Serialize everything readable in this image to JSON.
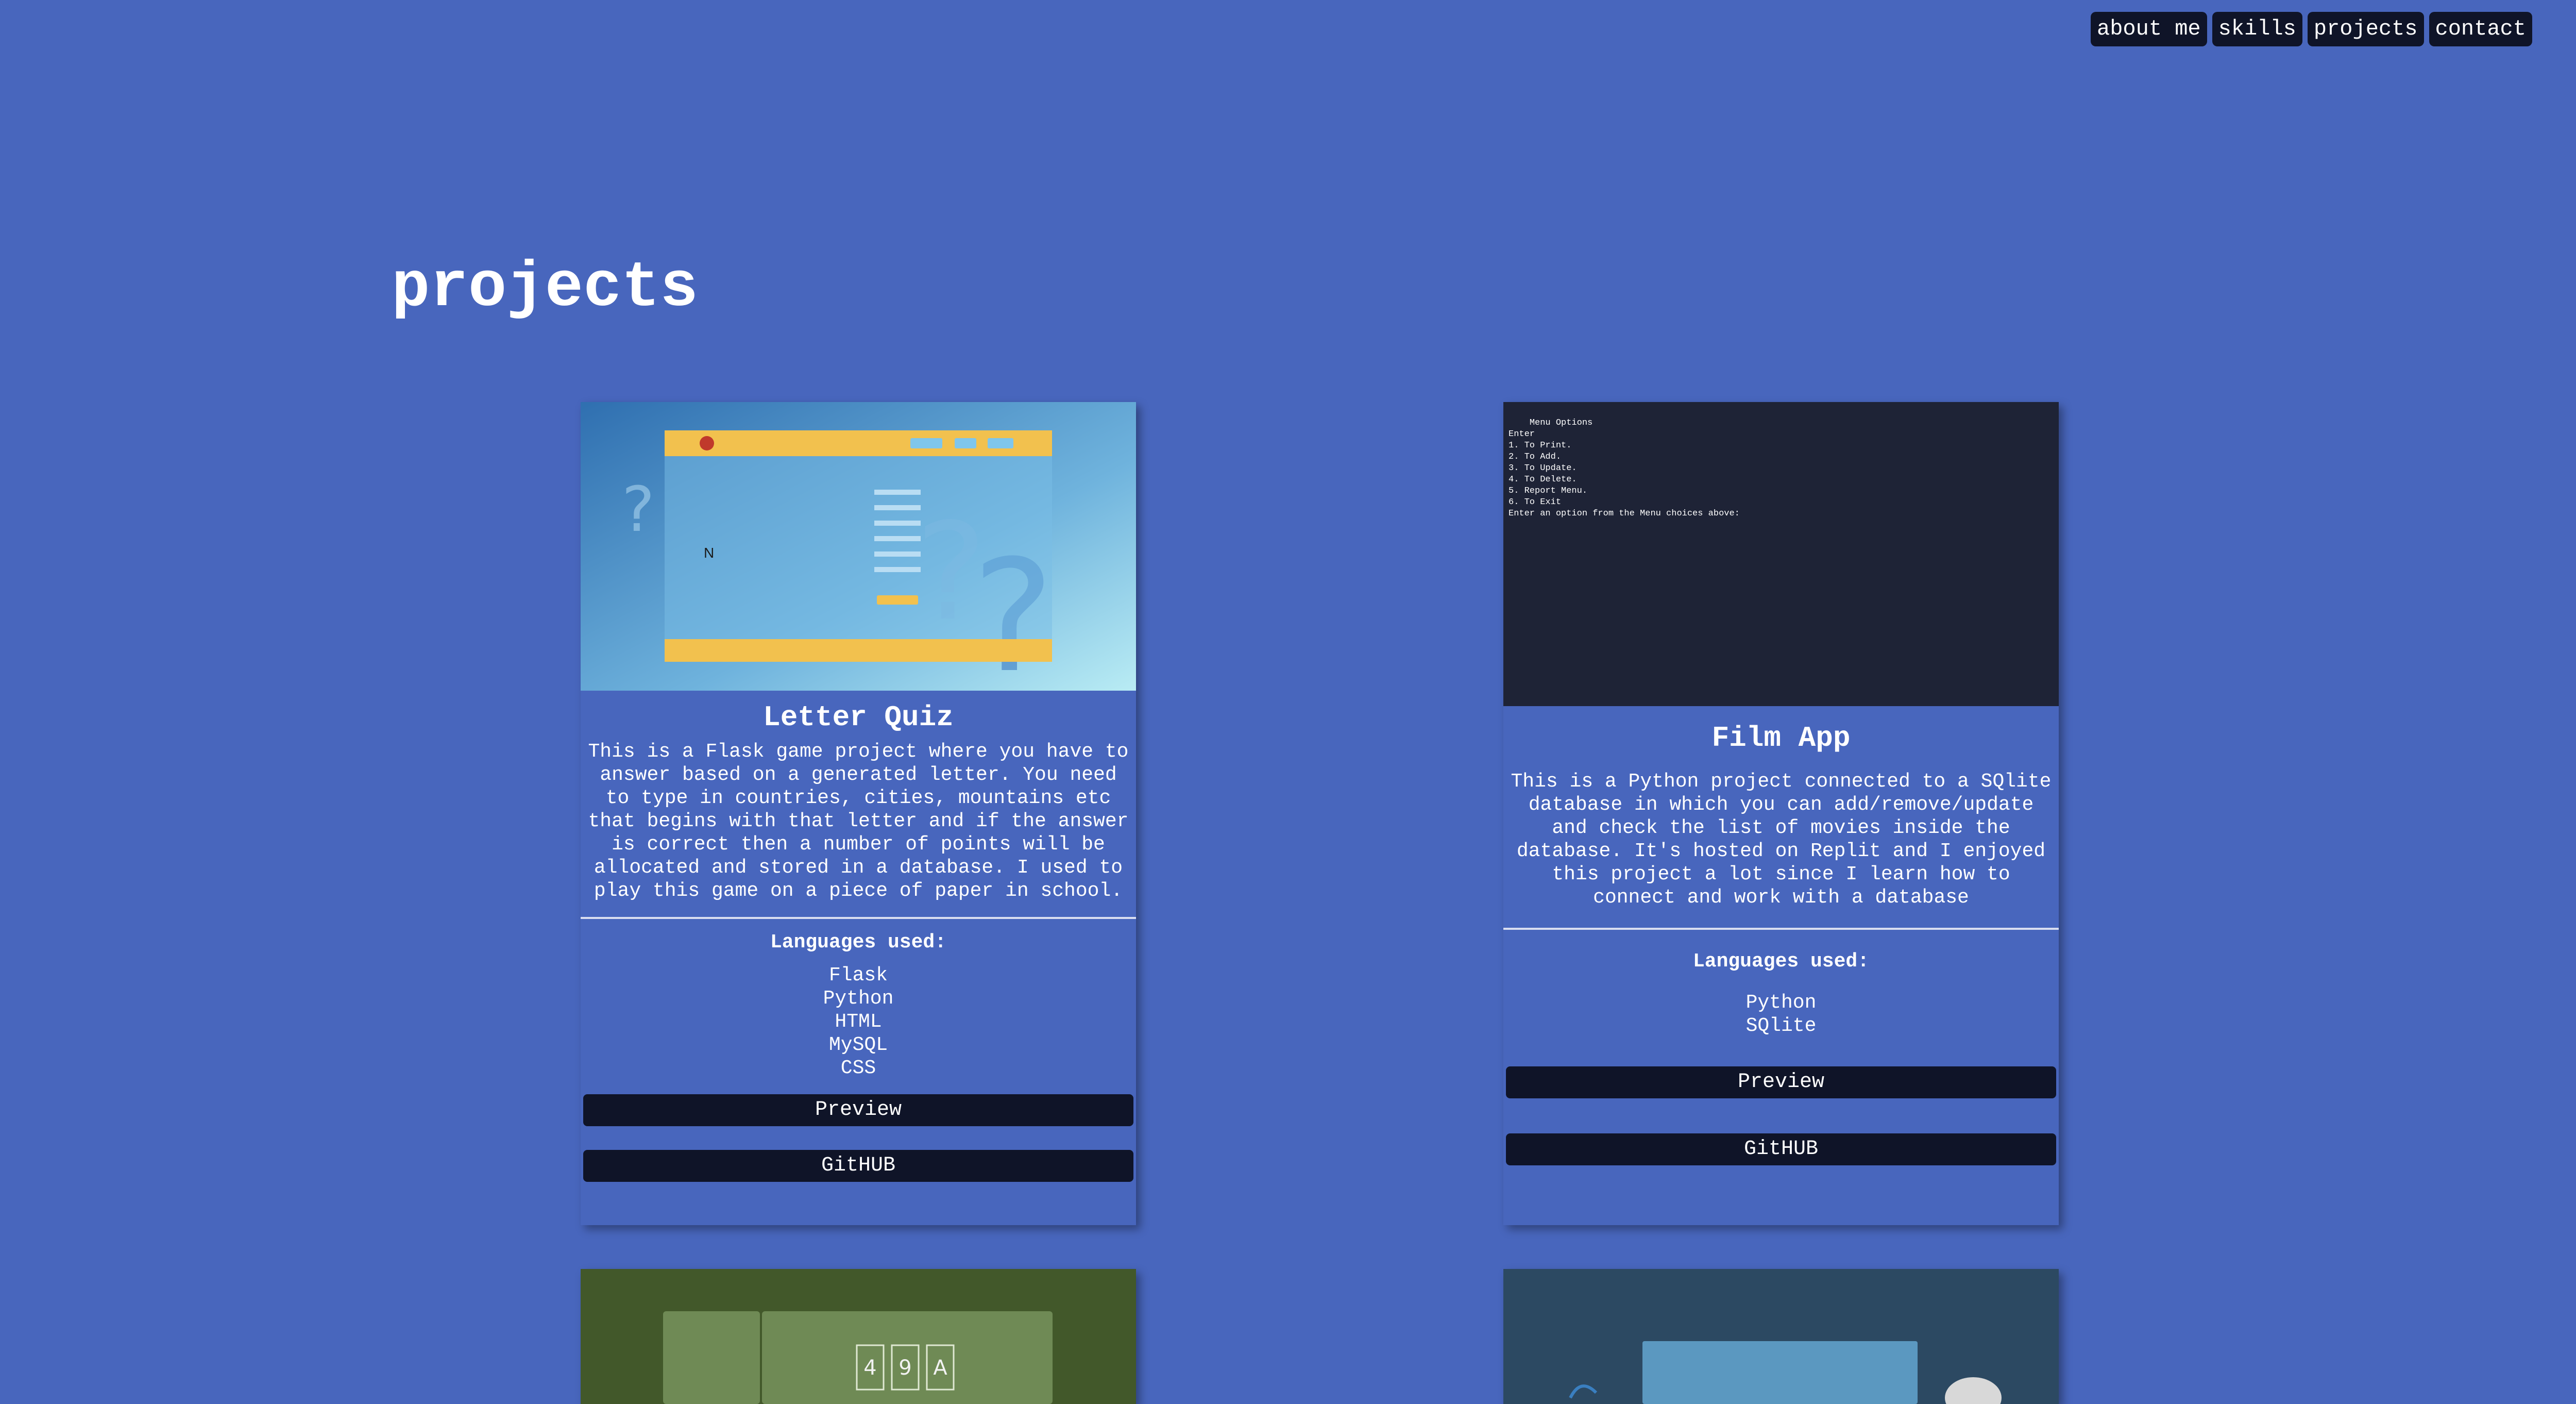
{
  "nav": {
    "about": "about me",
    "skills": "skills",
    "projects": "projects",
    "contact": "contact"
  },
  "page_title": "projects",
  "projects": [
    {
      "title": "Letter Quiz",
      "description": "This is a Flask game project where you have to answer based on a generated letter. You need to type in countries, cities, mountains etc that begins with that letter and if the answer is correct then a number of points will be allocated and stored in a database. I used to play this game on a piece of paper in school.",
      "languages_label": "Languages used:",
      "languages": [
        "Flask",
        "Python",
        "HTML",
        "MySQL",
        "CSS"
      ],
      "preview_label": "Preview",
      "github_label": "GitHUB",
      "screenshot": {
        "letter": "N"
      }
    },
    {
      "title": "Film App",
      "description": "This is a Python project connected to a SQlite database in which you can add/remove/update and check the list of movies inside the database. It's hosted on Replit and I enjoyed this project a lot since I learn how to connect and work with a database",
      "languages_label": "Languages used:",
      "languages": [
        "Python",
        "SQlite"
      ],
      "preview_label": "Preview",
      "github_label": "GitHUB",
      "screenshot": {
        "terminal": "Menu Options\nEnter\n1. To Print.\n2. To Add.\n3. To Update.\n4. To Delete.\n5. Report Menu.\n6. To Exit\nEnter an option from the Menu choices above:"
      }
    },
    {
      "screenshot": {
        "tiles": [
          "4",
          "9",
          "A"
        ]
      }
    },
    {
      "screenshot": {}
    }
  ],
  "colors": {
    "background": "#4866bd",
    "button": "#0f1428",
    "terminal": "#1e2336",
    "card3_bg": "#42582a",
    "card4_bg": "#2c4962"
  }
}
